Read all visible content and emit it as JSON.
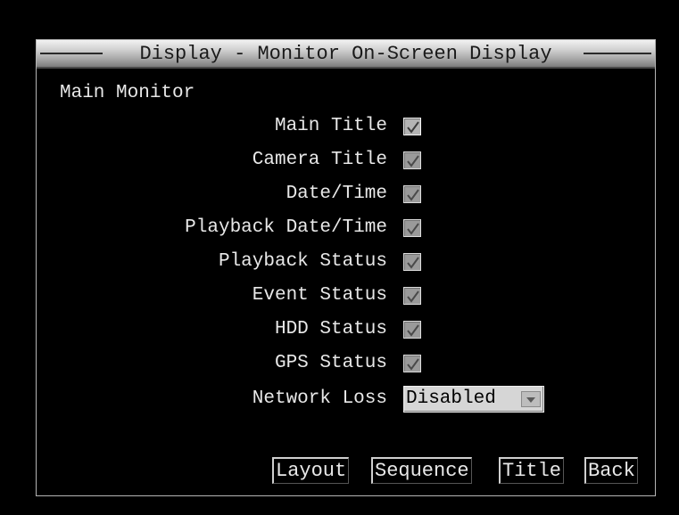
{
  "dialog": {
    "title": "Display - Monitor On-Screen Display",
    "section_label": "Main Monitor",
    "options": [
      {
        "label": "Main Title",
        "checked": true
      },
      {
        "label": "Camera Title",
        "checked": true
      },
      {
        "label": "Date/Time",
        "checked": true
      },
      {
        "label": "Playback Date/Time",
        "checked": true
      },
      {
        "label": "Playback Status",
        "checked": true
      },
      {
        "label": "Event Status",
        "checked": true
      },
      {
        "label": "HDD Status",
        "checked": true
      },
      {
        "label": "GPS Status",
        "checked": true
      }
    ],
    "network_loss": {
      "label": "Network Loss",
      "value": "Disabled"
    },
    "buttons": {
      "layout": "Layout",
      "sequence": "Sequence",
      "title": "Title",
      "back": "Back"
    }
  }
}
